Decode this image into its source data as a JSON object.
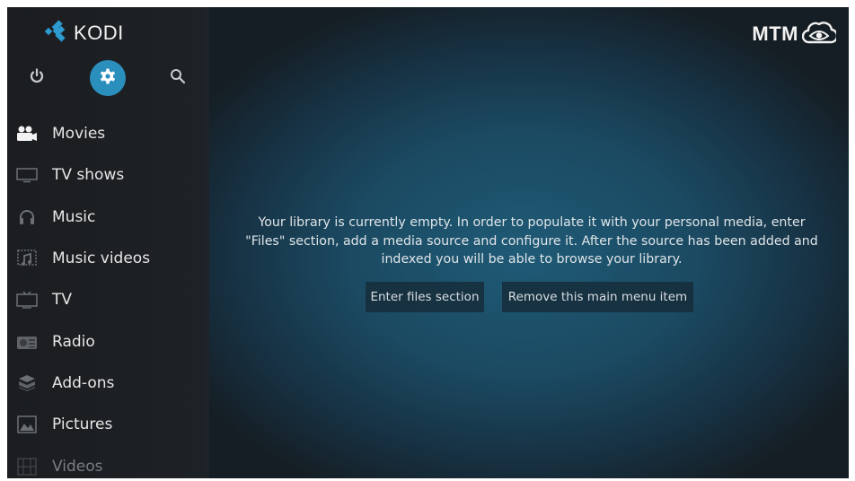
{
  "app": {
    "name": "KODI",
    "brand_watermark": "MTM"
  },
  "colors": {
    "accent": "#2a8fbd",
    "sidebar_bg": "#1c1f22",
    "main_center": "#1f5a76",
    "main_edge": "#151e24"
  },
  "top_icons": [
    {
      "name": "power-icon",
      "label": "Power"
    },
    {
      "name": "settings-icon",
      "label": "Settings",
      "selected": true
    },
    {
      "name": "search-icon",
      "label": "Search"
    }
  ],
  "sidebar": {
    "items": [
      {
        "label": "Movies",
        "icon": "movie-camera-icon"
      },
      {
        "label": "TV shows",
        "icon": "monitor-icon"
      },
      {
        "label": "Music",
        "icon": "headphones-icon"
      },
      {
        "label": "Music videos",
        "icon": "music-video-icon"
      },
      {
        "label": "TV",
        "icon": "tv-icon"
      },
      {
        "label": "Radio",
        "icon": "radio-icon"
      },
      {
        "label": "Add-ons",
        "icon": "addons-box-icon"
      },
      {
        "label": "Pictures",
        "icon": "picture-icon"
      },
      {
        "label": "Videos",
        "icon": "film-icon"
      }
    ]
  },
  "main": {
    "message_lines": [
      "Your library is currently empty. In order to populate it with your personal media, enter",
      "\"Files\" section, add a media source and configure it. After the source has been added and",
      "indexed you will be able to browse your library."
    ],
    "buttons": {
      "enter_files": "Enter files section",
      "remove_item": "Remove this main menu item"
    }
  }
}
